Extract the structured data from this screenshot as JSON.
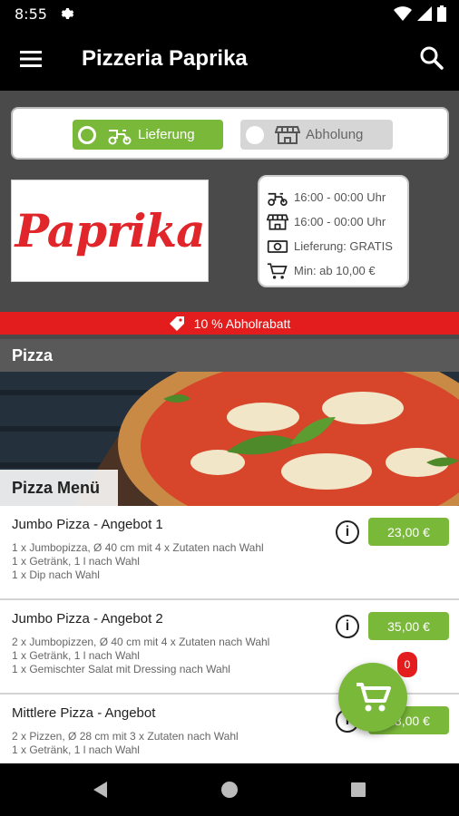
{
  "status_bar": {
    "time": "8:55"
  },
  "app_bar": {
    "title": "Pizzeria Paprika"
  },
  "mode_toggle": {
    "delivery_label": "Lieferung",
    "pickup_label": "Abholung",
    "selected": "delivery"
  },
  "logo": {
    "text": "Paprika"
  },
  "info": {
    "delivery_hours": "16:00 - 00:00 Uhr",
    "pickup_hours": "16:00 - 00:00 Uhr",
    "delivery_fee": "Lieferung: GRATIS",
    "minimum": "Min: ab 10,00 €"
  },
  "discount_banner": {
    "text": "10 % Abholrabatt"
  },
  "category": {
    "title": "Pizza",
    "subcategory": "Pizza Menü"
  },
  "menu_items": [
    {
      "name": "Jumbo Pizza - Angebot 1",
      "price": "23,00 €",
      "desc": [
        "1 x Jumbopizza, Ø 40 cm mit 4 x Zutaten nach Wahl",
        "1 x Getränk, 1 l nach Wahl",
        "1 x Dip nach Wahl"
      ]
    },
    {
      "name": "Jumbo Pizza - Angebot 2",
      "price": "35,00 €",
      "desc": [
        "2 x Jumbopizzen, Ø 40 cm mit 4 x Zutaten nach Wahl",
        "1 x Getränk, 1 l nach Wahl",
        "1 x Gemischter Salat mit Dressing nach Wahl"
      ]
    },
    {
      "name": "Mittlere Pizza - Angebot",
      "price": "18,00 €",
      "desc": [
        "2 x Pizzen, Ø 28 cm mit 3 x Zutaten nach Wahl",
        "1 x Getränk, 1 l nach Wahl"
      ]
    }
  ],
  "cart": {
    "count": "0"
  },
  "colors": {
    "accent_green": "#7ab83a",
    "accent_red": "#e31d1d",
    "background": "#4a4a4a"
  }
}
